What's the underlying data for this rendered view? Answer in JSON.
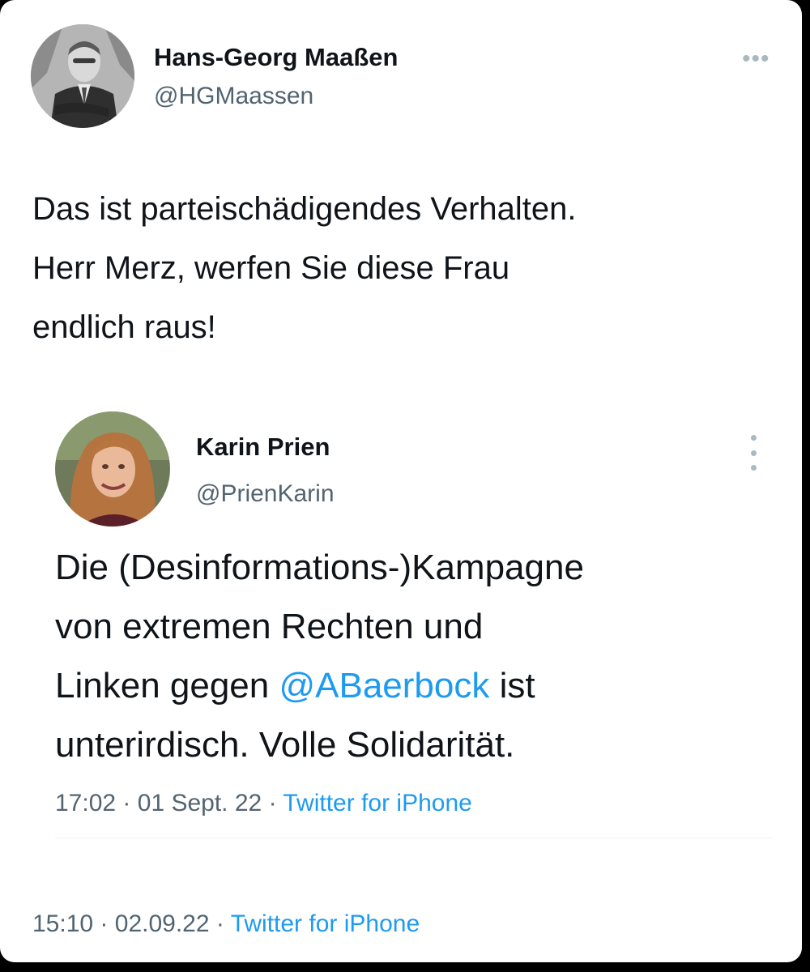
{
  "tweet": {
    "author_name": "Hans-Georg Maaßen",
    "author_handle": "@HGMaassen",
    "text_lines": [
      "Das ist parteischädigendes Verhalten.",
      "Herr Merz, werfen Sie diese Frau",
      "endlich raus!"
    ],
    "time": "15:10",
    "date": "02.09.22",
    "separator": "·",
    "source": "Twitter for iPhone",
    "avatar_icon": "profile-photo-hgmaassen"
  },
  "quoted_tweet": {
    "author_name": "Karin Prien",
    "author_handle": "@PrienKarin",
    "text_line_1": "Die (Desinformations-)Kampagne",
    "text_line_2": "von extremen Rechten und",
    "text_line_3_before": "Linken gegen ",
    "mention": "@ABaerbock",
    "text_line_3_after": " ist",
    "text_line_4": "unterirdisch. Volle Solidarität.",
    "time": "17:02",
    "date": "01 Sept. 22",
    "separator": "·",
    "source": "Twitter for iPhone",
    "avatar_icon": "profile-photo-prienkarin"
  },
  "colors": {
    "text": "#0f1419",
    "secondary": "#536471",
    "link": "#1d9bf0",
    "background": "#ffffff"
  },
  "icons": {
    "more_horizontal": "more-options-horizontal-icon",
    "more_vertical": "more-options-vertical-icon"
  }
}
